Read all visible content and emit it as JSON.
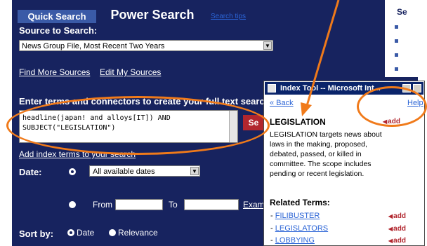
{
  "tabs": {
    "quick_search": "Quick Search",
    "power_search": "Power Search",
    "search_tips": "Search tips"
  },
  "source": {
    "label": "Source to Search:",
    "selected": "News Group File, Most Recent Two Years",
    "find_more": "Find More Sources",
    "edit_sources": "Edit My Sources"
  },
  "query": {
    "label": "Enter terms and connectors to create your full text search:",
    "line1": "headline(japan! and alloys[IT]) AND",
    "line2": "SUBJECT(\"LEGISLATION\")",
    "search_button": "Se",
    "add_index_terms": "Add index terms to your search"
  },
  "date": {
    "label": "Date:",
    "selected": "All available dates",
    "from_label": "From",
    "to_label": "To",
    "examples": "Exam"
  },
  "sort": {
    "label": "Sort by:",
    "date_option": "Date",
    "relevance_option": "Relevance"
  },
  "sidebar": {
    "heading": "Se"
  },
  "index_tool": {
    "title": "Index Tool -- Microsoft Int...",
    "back_link": "« Back",
    "help_link": "Help",
    "term": "LEGISLATION",
    "add_label": "add",
    "description": "LEGISLATION targets news about laws in the making, proposed, debated, passed, or killed in committee. The scope includes pending or recent legislation.",
    "related_heading": "Related Terms:",
    "related_terms": [
      {
        "term": "FILIBUSTER",
        "add": "add"
      },
      {
        "term": "LEGISLATORS",
        "add": "add"
      },
      {
        "term": "LOBBYING",
        "add": "add"
      }
    ]
  },
  "colors": {
    "panel": "#17235f",
    "annotation": "#f07a1a",
    "add_red": "#b1262e",
    "link_blue": "#2b64d6"
  }
}
